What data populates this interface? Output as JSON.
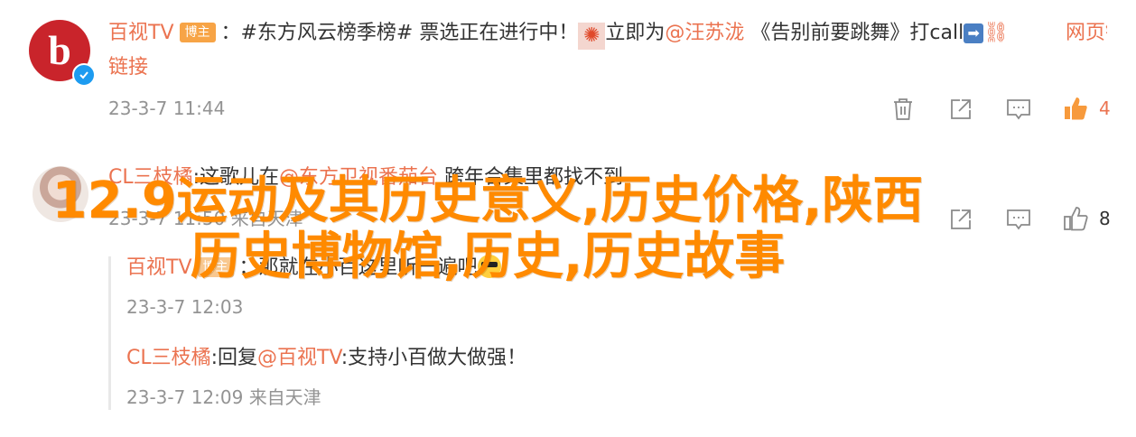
{
  "comment1": {
    "user": "百视TV",
    "badge": "博主",
    "text_part1": "：#东方风云榜季榜# 票选正在进行中！",
    "text_part2": "立即为",
    "mention": "@汪苏泷",
    "text_part3": " 《告别前要跳舞》打call",
    "link_label": "网页链接",
    "timestamp": "23-3-7 11:44",
    "likes": "4"
  },
  "comment2": {
    "user": "CL三枝橘",
    "text_part1": ":这歌儿在",
    "mention": "@东方卫视番茄台",
    "text_part2": " 跨年合集里都找不到",
    "timestamp": "23-3-7 11:50",
    "location": "来自天津",
    "likes": "8",
    "replies": [
      {
        "user": "百视TV",
        "badge": "博主",
        "text": "：那就在小百这里听一遍吧",
        "timestamp": "23-3-7 12:03"
      },
      {
        "user": "CL三枝橘",
        "text_part1": ":回复",
        "mention": "@百视TV",
        "text_part2": ":支持小百做大做强！",
        "timestamp": "23-3-7 12:09",
        "location": "来自天津"
      }
    ]
  },
  "overlay": {
    "line1": "12.9运动及其历史意义,历史价格,陕西",
    "line2": "历史博物馆,历史,历史故事"
  },
  "colors": {
    "username": "#eb7350",
    "meta": "#939393",
    "badge": "#f7a446",
    "watermark": "#ff8a00"
  }
}
